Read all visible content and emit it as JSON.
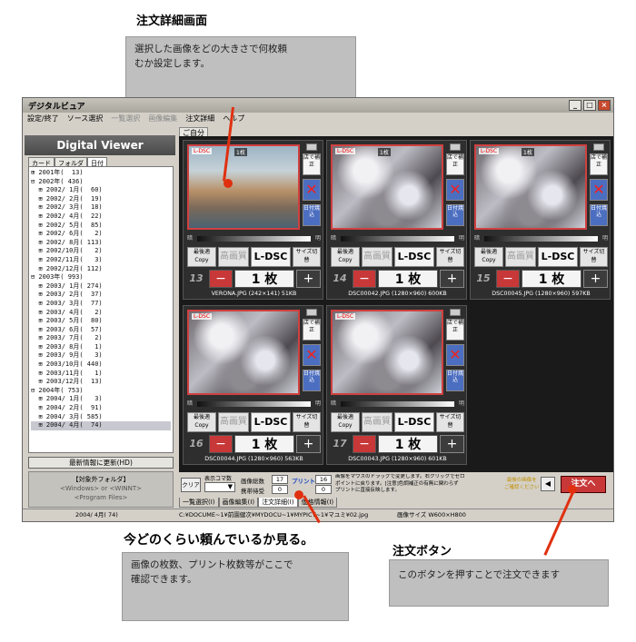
{
  "annotations": {
    "detail_title": "注文詳細画面",
    "detail_desc_1": "選択した画像をどの大きさで何枚頼",
    "detail_desc_2": "むか設定します。",
    "summary_title": "今どのくらい頼んでいるか見る。",
    "summary_desc_1": "画像の枚数、プリント枚数等がここで",
    "summary_desc_2": "確認できます。",
    "order_title": "注文ボタン",
    "order_desc": "このボタンを押すことで注文できます"
  },
  "window": {
    "title": "デジタルビュア"
  },
  "menu": [
    "設定/終了",
    "ソース選択",
    "一覧選択",
    "画像編集",
    "注文詳細",
    "ヘルプ"
  ],
  "menu_disabled": [
    false,
    false,
    true,
    true,
    false,
    false
  ],
  "left": {
    "app_title": "Digital Viewer",
    "tabs": [
      "カード",
      "フォルダ",
      "日付"
    ],
    "tree": [
      "⊞ 2001年(  13)",
      "⊟ 2002年( 436)",
      "  ⊞ 2002/ 1月(  60)",
      "  ⊞ 2002/ 2月(  19)",
      "  ⊞ 2002/ 3月(  18)",
      "  ⊞ 2002/ 4月(  22)",
      "  ⊞ 2002/ 5月(  85)",
      "  ⊞ 2002/ 6月(   2)",
      "  ⊞ 2002/ 8月( 113)",
      "  ⊞ 2002/10月(   2)",
      "  ⊞ 2002/11月(   3)",
      "  ⊞ 2002/12月( 112)",
      "⊟ 2003年( 993)",
      "  ⊞ 2003/ 1月( 274)",
      "  ⊞ 2003/ 2月(  37)",
      "  ⊞ 2003/ 3月(  77)",
      "  ⊞ 2003/ 4月(   2)",
      "  ⊞ 2003/ 5月(  80)",
      "  ⊞ 2003/ 6月(  57)",
      "  ⊞ 2003/ 7月(   2)",
      "  ⊞ 2003/ 8月(   1)",
      "  ⊞ 2003/ 9月(   3)",
      "  ⊞ 2003/10月( 440)",
      "  ⊞ 2003/11月(   1)",
      "  ⊞ 2003/12月(  13)",
      "⊟ 2004年( 753)",
      "  ⊞ 2004/ 1月(   3)",
      "  ⊞ 2004/ 2月(  91)",
      "  ⊞ 2004/ 3月( 585)",
      "  ⊞ 2004/ 4月(  74)"
    ],
    "update_button": "最新情報に更新(HD)",
    "target_title": "【対象外フォルダ】",
    "target_1": "<Windows> or <WINNT>",
    "target_2": "<Program Files>"
  },
  "main_tab": "ご自分",
  "cards": [
    {
      "num": "13",
      "file": "VERONA.JPG (242×141) 51KB",
      "count": "1枚",
      "photo": "venice"
    },
    {
      "num": "14",
      "file": "DSC00042.JPG (1280×960) 600KB",
      "count": "1枚",
      "photo": "sakura"
    },
    {
      "num": "15",
      "file": "DSC00045.JPG (1280×960) 597KB",
      "count": "1枚",
      "photo": "sakura"
    },
    {
      "num": "16",
      "file": "DSC00044.JPG (1280×960) 563KB",
      "count": "",
      "photo": "sakura"
    },
    {
      "num": "17",
      "file": "DSC00043.JPG (1280×960) 601KB",
      "count": "",
      "photo": "sakura"
    }
  ],
  "card_labels": {
    "ldsc_tag": "L-DSC",
    "store_fix": "店で補正",
    "date_print": "日付焼込",
    "dark": "暗",
    "light": "明",
    "saiteki": "最後適Copy",
    "kogazo": "高画質",
    "size_name": "L-DSC",
    "size_change": "サイズ切替",
    "minus": "−",
    "qty": "1 枚",
    "plus": "+"
  },
  "bottom": {
    "clear": "クリア",
    "display_unit": "表示コマ数",
    "total_label": "画像総数",
    "total_value": "17",
    "print_label": "プリント",
    "print_value": "16",
    "carry_label": "携帯待受",
    "carry_value": "0",
    "carry_value2": "0",
    "hint_1": "画像をマウスのドラッグで変更します。右クリックでゼロ",
    "hint_2": "ポイントに戻ります。[注意]色調補正の有無に関わらず",
    "hint_3": "プリントに直接反映します。",
    "best": "最後の画像を",
    "best2": "ご確認ください",
    "prev": "◀",
    "next": "▶",
    "order": "注文へ"
  },
  "bottom_tabs": [
    "一覧選択(I)",
    "画像編集(I)",
    "注文詳細(I)",
    "価格情報(I)"
  ],
  "status": {
    "date": "2004/ 4月( 74)",
    "path": "C:¥DOCUME~1¥前園健次¥MYDOCU~1¥MYPICT~1¥マユミ¥02.jpg",
    "size": "画像サイズ W600×H800"
  }
}
